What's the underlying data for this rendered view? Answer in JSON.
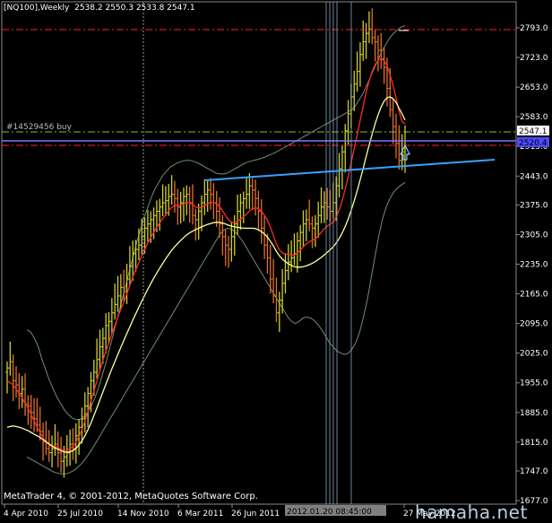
{
  "header": {
    "symbol_label": "[NQ100],Weekly",
    "ohlc_label": "2538.2 2550.3 2533.8 2547.1"
  },
  "order": {
    "label": "#14529456 buy"
  },
  "current_price_tag": "2547.1",
  "order_price_tag": "2520.4",
  "copyright": "MetaTrader 4, © 2001-2012, MetaQuotes Software Corp.",
  "watermark": "hamaha.net",
  "crosshair_time_label": "2012.01.20 08:45:00",
  "colors": {
    "background": "#000000",
    "bull_bar": "#cfcf2a",
    "bear_bar": "#e0702a",
    "ema_fast": "#ff2a2a",
    "ma_slow": "#ffff9a",
    "bands": "#6f8f6f",
    "trendline": "#3aa0ff",
    "order_line": "#7a7aff",
    "red_dashdot": "#ff2020",
    "green_dashdot": "#7fbf3f"
  },
  "chart_data": {
    "type": "candlestick",
    "y_ticks": [
      "2793.0",
      "2723.0",
      "2653.0",
      "2583.0",
      "2513.0",
      "2443.0",
      "2375.0",
      "2305.0",
      "2235.0",
      "2165.0",
      "2095.0",
      "2025.0",
      "1955.0",
      "1885.0",
      "1815.0",
      "1747.0",
      "1677.0"
    ],
    "x_ticks": [
      "4 Apr 2010",
      "25 Jul 2010",
      "14 Nov 2010",
      "6 Mar 2011",
      "26 Jun 2011",
      "27 May 2012"
    ],
    "ylim": [
      1677,
      2820
    ],
    "close_series": [
      1990,
      2005,
      1960,
      1950,
      1930,
      1940,
      1905,
      1900,
      1885,
      1870,
      1855,
      1840,
      1815,
      1800,
      1790,
      1800,
      1810,
      1790,
      1770,
      1780,
      1790,
      1810,
      1800,
      1830,
      1850,
      1870,
      1900,
      1930,
      1960,
      1980,
      2010,
      2040,
      2060,
      2090,
      2100,
      2120,
      2140,
      2160,
      2180,
      2170,
      2200,
      2230,
      2260,
      2270,
      2280,
      2300,
      2320,
      2330,
      2340,
      2350,
      2360,
      2370,
      2380,
      2385,
      2395,
      2400,
      2390,
      2370,
      2380,
      2395,
      2400,
      2380,
      2350,
      2340,
      2360,
      2380,
      2400,
      2410,
      2400,
      2380,
      2360,
      2330,
      2300,
      2280,
      2270,
      2300,
      2330,
      2360,
      2380,
      2390,
      2400,
      2420,
      2410,
      2390,
      2360,
      2320,
      2280,
      2250,
      2200,
      2160,
      2120,
      2150,
      2190,
      2220,
      2240,
      2250,
      2260,
      2290,
      2310,
      2330,
      2340,
      2330,
      2320,
      2330,
      2350,
      2370,
      2380,
      2370,
      2360,
      2380,
      2420,
      2460,
      2500,
      2550,
      2590,
      2630,
      2660,
      2690,
      2730,
      2760,
      2780,
      2790,
      2770,
      2760,
      2740,
      2720,
      2700,
      2650,
      2600,
      2560,
      2520,
      2480,
      2500,
      2547
    ],
    "ema_fast": [
      1960,
      1955,
      1950,
      1940,
      1930,
      1920,
      1905,
      1895,
      1880,
      1865,
      1850,
      1838,
      1825,
      1815,
      1808,
      1805,
      1806,
      1802,
      1798,
      1795,
      1796,
      1800,
      1805,
      1815,
      1828,
      1845,
      1865,
      1888,
      1912,
      1936,
      1960,
      1985,
      2008,
      2030,
      2050,
      2070,
      2090,
      2110,
      2130,
      2145,
      2165,
      2185,
      2205,
      2222,
      2238,
      2255,
      2270,
      2285,
      2298,
      2310,
      2322,
      2333,
      2343,
      2352,
      2361,
      2369,
      2374,
      2374,
      2375,
      2378,
      2381,
      2381,
      2376,
      2370,
      2368,
      2369,
      2373,
      2378,
      2381,
      2381,
      2378,
      2371,
      2361,
      2350,
      2340,
      2334,
      2333,
      2336,
      2341,
      2347,
      2353,
      2361,
      2366,
      2368,
      2366,
      2360,
      2350,
      2339,
      2322,
      2303,
      2282,
      2269,
      2262,
      2259,
      2258,
      2257,
      2257,
      2262,
      2268,
      2276,
      2283,
      2288,
      2291,
      2295,
      2302,
      2310,
      2319,
      2325,
      2329,
      2335,
      2347,
      2364,
      2385,
      2412,
      2442,
      2475,
      2508,
      2540,
      2574,
      2608,
      2640,
      2668,
      2690,
      2706,
      2717,
      2719,
      2716,
      2703,
      2682,
      2657,
      2628,
      2596,
      2572,
      2566
    ],
    "ma_slow": [
      1850,
      1852,
      1853,
      1852,
      1850,
      1848,
      1845,
      1842,
      1838,
      1834,
      1830,
      1826,
      1821,
      1816,
      1811,
      1806,
      1802,
      1798,
      1795,
      1792,
      1791,
      1792,
      1795,
      1800,
      1808,
      1818,
      1830,
      1844,
      1860,
      1878,
      1896,
      1915,
      1933,
      1952,
      1970,
      1988,
      2005,
      2022,
      2039,
      2055,
      2071,
      2087,
      2103,
      2118,
      2133,
      2148,
      2162,
      2176,
      2189,
      2202,
      2214,
      2226,
      2237,
      2248,
      2258,
      2268,
      2276,
      2284,
      2291,
      2298,
      2304,
      2309,
      2313,
      2317,
      2320,
      2323,
      2326,
      2329,
      2331,
      2333,
      2334,
      2334,
      2332,
      2330,
      2327,
      2325,
      2323,
      2322,
      2321,
      2320,
      2320,
      2320,
      2320,
      2319,
      2316,
      2312,
      2306,
      2299,
      2289,
      2278,
      2265,
      2255,
      2247,
      2241,
      2236,
      2232,
      2229,
      2228,
      2228,
      2229,
      2231,
      2234,
      2237,
      2241,
      2246,
      2251,
      2257,
      2263,
      2269,
      2276,
      2285,
      2296,
      2309,
      2324,
      2342,
      2362,
      2384,
      2408,
      2434,
      2461,
      2489,
      2516,
      2542,
      2566,
      2588,
      2606,
      2620,
      2628,
      2630,
      2626,
      2617,
      2603,
      2590,
      2575
    ],
    "band_upper": [
      2080,
      2075,
      2060,
      2040,
      2010,
      1985,
      1960,
      1940,
      1920,
      1905,
      1890,
      1880,
      1872,
      1868,
      1868,
      1875,
      1885,
      1900,
      1920,
      1945,
      1975,
      2005,
      2040,
      2075,
      2110,
      2145,
      2180,
      2215,
      2250,
      2285,
      2315,
      2345,
      2370,
      2395,
      2415,
      2430,
      2445,
      2455,
      2465,
      2470,
      2475,
      2478,
      2480,
      2480,
      2478,
      2475,
      2470,
      2465,
      2460,
      2455,
      2450,
      2448,
      2448,
      2450,
      2455,
      2460,
      2465,
      2470,
      2475,
      2478,
      2480,
      2482,
      2485,
      2488,
      2492,
      2496,
      2500,
      2505,
      2510,
      2515,
      2520,
      2525,
      2530,
      2535,
      2540,
      2545,
      2550,
      2555,
      2560,
      2565,
      2570,
      2575,
      2580,
      2585,
      2590,
      2595,
      2600,
      2610,
      2625,
      2640,
      2660,
      2680,
      2700,
      2720,
      2740,
      2755,
      2770,
      2780,
      2788,
      2795,
      2798
    ],
    "band_lower": [
      1780,
      1775,
      1770,
      1765,
      1760,
      1755,
      1750,
      1745,
      1742,
      1740,
      1740,
      1742,
      1746,
      1752,
      1760,
      1770,
      1782,
      1795,
      1810,
      1825,
      1840,
      1855,
      1870,
      1885,
      1900,
      1915,
      1930,
      1945,
      1960,
      1975,
      1990,
      2005,
      2020,
      2035,
      2050,
      2065,
      2080,
      2095,
      2110,
      2125,
      2140,
      2155,
      2170,
      2185,
      2200,
      2215,
      2230,
      2245,
      2260,
      2275,
      2290,
      2305,
      2315,
      2320,
      2318,
      2312,
      2302,
      2290,
      2275,
      2260,
      2245,
      2230,
      2215,
      2200,
      2185,
      2170,
      2155,
      2140,
      2125,
      2110,
      2100,
      2095,
      2100,
      2108,
      2110,
      2108,
      2102,
      2092,
      2080,
      2065,
      2050,
      2040,
      2030,
      2025,
      2022,
      2025,
      2035,
      2050,
      2075,
      2110,
      2150,
      2200,
      2250,
      2300,
      2340,
      2370,
      2390,
      2405,
      2415,
      2422,
      2428
    ],
    "levels": {
      "red_dashdot_top": 2785,
      "green_dashdot": 2547.1,
      "blue_solid": 2525,
      "red_dashdot_low": 2512
    },
    "trendline": {
      "from": [
        "4 Apr 2011",
        2425
      ],
      "to": [
        "Jun 2012",
        2470
      ]
    }
  }
}
